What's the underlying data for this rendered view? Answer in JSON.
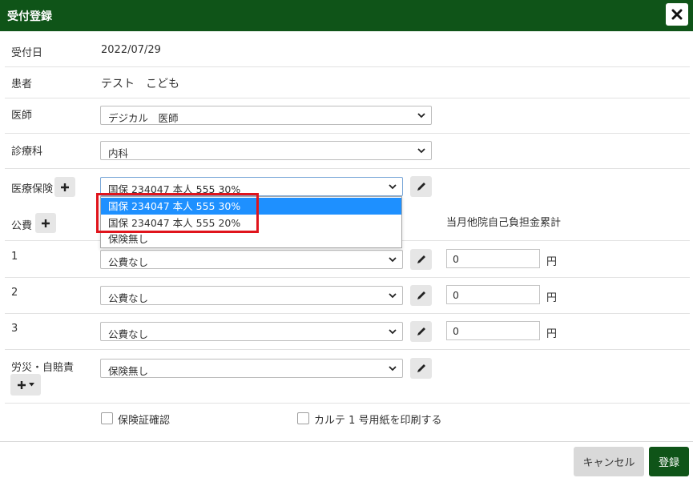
{
  "dialog": {
    "title": "受付登録"
  },
  "fields": {
    "reception_date": {
      "label": "受付日",
      "value": "2022/07/29"
    },
    "patient": {
      "label": "患者",
      "value": "テスト　こども"
    },
    "doctor": {
      "label": "医師",
      "value": "デジカル　医師"
    },
    "department": {
      "label": "診療科",
      "value": "内科"
    },
    "insurance": {
      "label": "医療保険",
      "value": "国保 234047 本人 555 30%"
    }
  },
  "insurance_dropdown": {
    "options": [
      "国保 234047 本人 555 30%",
      "国保 234047 本人 555 20%",
      "保険無し"
    ],
    "selected_index": 0
  },
  "public_expense": {
    "label": "公費",
    "total_header": "当月他院自己負担金累計",
    "rows": [
      {
        "number": "1",
        "value": "公費なし",
        "amount": "0",
        "unit": "円"
      },
      {
        "number": "2",
        "value": "公費なし",
        "amount": "0",
        "unit": "円"
      },
      {
        "number": "3",
        "value": "公費なし",
        "amount": "0",
        "unit": "円"
      }
    ]
  },
  "workers_comp": {
    "label": "労災・自賠責",
    "value": "保険無し"
  },
  "checks": {
    "insurance_card": "保険証確認",
    "print_karte": "カルテ 1 号用紙を印刷する"
  },
  "buttons": {
    "cancel": "キャンセル",
    "submit": "登録"
  }
}
